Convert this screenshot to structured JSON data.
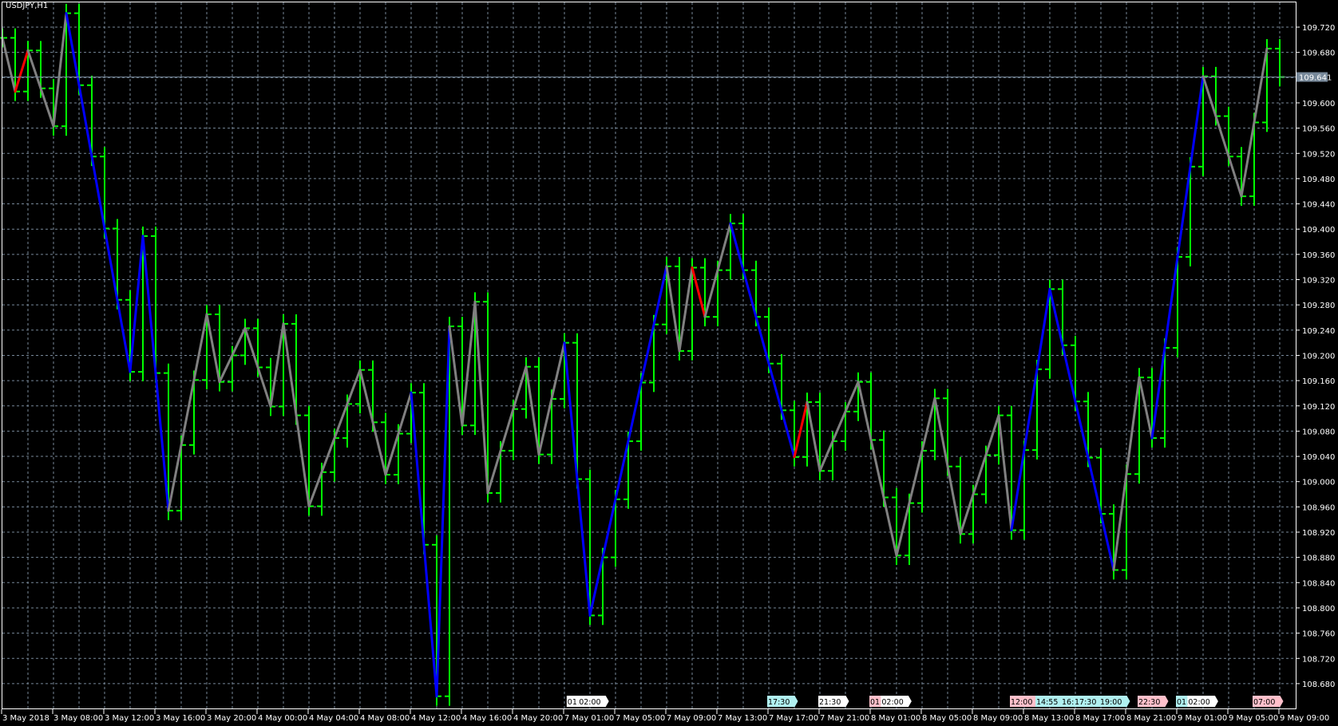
{
  "window": {
    "title": "USDJPY,H1"
  },
  "colors": {
    "background": "#000000",
    "grid": "#778899",
    "bars": "#00ff00",
    "axis": "#ffffff",
    "price_line": "#778899",
    "zz_gray": "#808080",
    "zz_red": "#ff0000",
    "zz_blue": "#0000ff",
    "tag_white": "#ffffff",
    "tag_pink": "#ffc0cb",
    "tag_cyan": "#b0f0f0"
  },
  "chart_data": {
    "type": "ohlc",
    "symbol": "USDJPY",
    "timeframe": "H1",
    "ylim": [
      108.64,
      109.76
    ],
    "y_ticks": [
      "109.720",
      "109.680",
      "109.600",
      "109.560",
      "109.520",
      "109.480",
      "109.440",
      "109.400",
      "109.360",
      "109.320",
      "109.280",
      "109.240",
      "109.200",
      "109.160",
      "109.120",
      "109.080",
      "109.040",
      "109.000",
      "108.960",
      "108.920",
      "108.880",
      "108.840",
      "108.800",
      "108.760",
      "108.720",
      "108.680"
    ],
    "current_price": "109.641",
    "x_labels": [
      {
        "bar": 0,
        "text": "3 May 2018"
      },
      {
        "bar": 4,
        "text": "3 May 08:00"
      },
      {
        "bar": 8,
        "text": "3 May 12:00"
      },
      {
        "bar": 12,
        "text": "3 May 16:00"
      },
      {
        "bar": 16,
        "text": "3 May 20:00"
      },
      {
        "bar": 20,
        "text": "4 May 00:00"
      },
      {
        "bar": 24,
        "text": "4 May 04:00"
      },
      {
        "bar": 28,
        "text": "4 May 08:00"
      },
      {
        "bar": 32,
        "text": "4 May 12:00"
      },
      {
        "bar": 36,
        "text": "4 May 16:00"
      },
      {
        "bar": 40,
        "text": "4 May 20:00"
      },
      {
        "bar": 44,
        "text": "7 May 01:00"
      },
      {
        "bar": 48,
        "text": "7 May 05:00"
      },
      {
        "bar": 52,
        "text": "7 May 09:00"
      },
      {
        "bar": 56,
        "text": "7 May 13:00"
      },
      {
        "bar": 60,
        "text": "7 May 17:00"
      },
      {
        "bar": 64,
        "text": "7 May 21:00"
      },
      {
        "bar": 68,
        "text": "8 May 01:00"
      },
      {
        "bar": 72,
        "text": "8 May 05:00"
      },
      {
        "bar": 76,
        "text": "8 May 09:00"
      },
      {
        "bar": 80,
        "text": "8 May 13:00"
      },
      {
        "bar": 84,
        "text": "8 May 17:00"
      },
      {
        "bar": 88,
        "text": "8 May 21:00"
      },
      {
        "bar": 92,
        "text": "9 May 01:00"
      },
      {
        "bar": 96,
        "text": "9 May 05:00"
      },
      {
        "bar": 100,
        "text": "9 May 09:00"
      }
    ],
    "bar_pad": 0.015,
    "close": [
      109.703,
      109.618,
      109.683,
      109.623,
      109.563,
      109.742,
      109.628,
      109.515,
      109.401,
      109.288,
      109.174,
      109.389,
      109.172,
      108.954,
      109.058,
      109.161,
      109.265,
      109.158,
      109.2,
      109.243,
      109.181,
      109.119,
      109.25,
      109.105,
      108.961,
      109.015,
      109.069,
      109.123,
      109.177,
      109.094,
      109.011,
      109.076,
      109.141,
      108.9,
      108.66,
      109.246,
      109.089,
      109.285,
      108.982,
      109.049,
      109.115,
      109.182,
      109.043,
      109.131,
      109.22,
      109.004,
      108.788,
      108.88,
      108.972,
      109.064,
      109.157,
      109.249,
      109.341,
      109.207,
      109.339,
      109.261,
      109.335,
      109.409,
      109.335,
      109.261,
      109.187,
      109.113,
      109.039,
      109.126,
      109.017,
      109.064,
      109.111,
      109.158,
      109.066,
      108.975,
      108.883,
      108.966,
      109.049,
      109.132,
      109.024,
      108.917,
      108.98,
      109.042,
      109.105,
      108.923,
      109.05,
      109.178,
      109.305,
      109.216,
      109.127,
      109.038,
      108.949,
      108.86,
      109.012,
      109.165,
      109.069,
      109.212,
      109.356,
      109.499,
      109.642,
      109.579,
      109.515,
      109.452,
      109.569,
      109.686,
      109.641
    ],
    "zigzag": [
      [
        0,
        109.703,
        "gray"
      ],
      [
        1,
        109.618,
        "red"
      ],
      [
        2,
        109.683,
        "gray"
      ],
      [
        4,
        109.563,
        "gray"
      ],
      [
        5,
        109.742,
        "blue"
      ],
      [
        10,
        109.174,
        "blue"
      ],
      [
        11,
        109.389,
        "blue"
      ],
      [
        13,
        108.954,
        "gray"
      ],
      [
        16,
        109.265,
        "gray"
      ],
      [
        17,
        109.158,
        "gray"
      ],
      [
        19,
        109.243,
        "gray"
      ],
      [
        21,
        109.119,
        "gray"
      ],
      [
        22,
        109.25,
        "gray"
      ],
      [
        24,
        108.961,
        "gray"
      ],
      [
        28,
        109.177,
        "gray"
      ],
      [
        30,
        109.011,
        "gray"
      ],
      [
        32,
        109.141,
        "blue"
      ],
      [
        34,
        108.66,
        "blue"
      ],
      [
        35,
        109.246,
        "gray"
      ],
      [
        36,
        109.089,
        "gray"
      ],
      [
        37,
        109.285,
        "gray"
      ],
      [
        38,
        108.982,
        "gray"
      ],
      [
        41,
        109.182,
        "gray"
      ],
      [
        42,
        109.043,
        "gray"
      ],
      [
        44,
        109.22,
        "blue"
      ],
      [
        46,
        108.788,
        "blue"
      ],
      [
        52,
        109.341,
        "gray"
      ],
      [
        53,
        109.207,
        "gray"
      ],
      [
        54,
        109.339,
        "red"
      ],
      [
        55,
        109.261,
        "gray"
      ],
      [
        57,
        109.409,
        "blue"
      ],
      [
        62,
        109.039,
        "red"
      ],
      [
        63,
        109.126,
        "gray"
      ],
      [
        64,
        109.017,
        "gray"
      ],
      [
        67,
        109.158,
        "gray"
      ],
      [
        70,
        108.883,
        "gray"
      ],
      [
        73,
        109.132,
        "gray"
      ],
      [
        75,
        108.917,
        "gray"
      ],
      [
        78,
        109.105,
        "gray"
      ],
      [
        79,
        108.923,
        "blue"
      ],
      [
        82,
        109.305,
        "blue"
      ],
      [
        87,
        108.86,
        "gray"
      ],
      [
        89,
        109.165,
        "gray"
      ],
      [
        90,
        109.069,
        "blue"
      ],
      [
        94,
        109.642,
        "gray"
      ],
      [
        97,
        109.452,
        "gray"
      ],
      [
        99,
        109.686,
        "gray"
      ]
    ],
    "session_tags": [
      {
        "bar": 44.3,
        "text": "01:",
        "color": "white"
      },
      {
        "bar": 45.2,
        "text": "02:00",
        "color": "white"
      },
      {
        "bar": 60,
        "text": "17:30",
        "color": "cyan"
      },
      {
        "bar": 64,
        "text": "21:30",
        "color": "white"
      },
      {
        "bar": 68,
        "text": "01:",
        "color": "pink"
      },
      {
        "bar": 68.9,
        "text": "02:00",
        "color": "white"
      },
      {
        "bar": 79,
        "text": "12:00",
        "color": "pink"
      },
      {
        "bar": 81,
        "text": "14:55",
        "color": "cyan"
      },
      {
        "bar": 83,
        "text": "16:",
        "color": "cyan"
      },
      {
        "bar": 84,
        "text": "17:30",
        "color": "cyan"
      },
      {
        "bar": 86,
        "text": "19:00",
        "color": "cyan"
      },
      {
        "bar": 89,
        "text": "22:30",
        "color": "pink"
      },
      {
        "bar": 92,
        "text": "01:",
        "color": "cyan"
      },
      {
        "bar": 92.9,
        "text": "02:00",
        "color": "white"
      },
      {
        "bar": 98,
        "text": "07:00",
        "color": "pink"
      }
    ]
  }
}
